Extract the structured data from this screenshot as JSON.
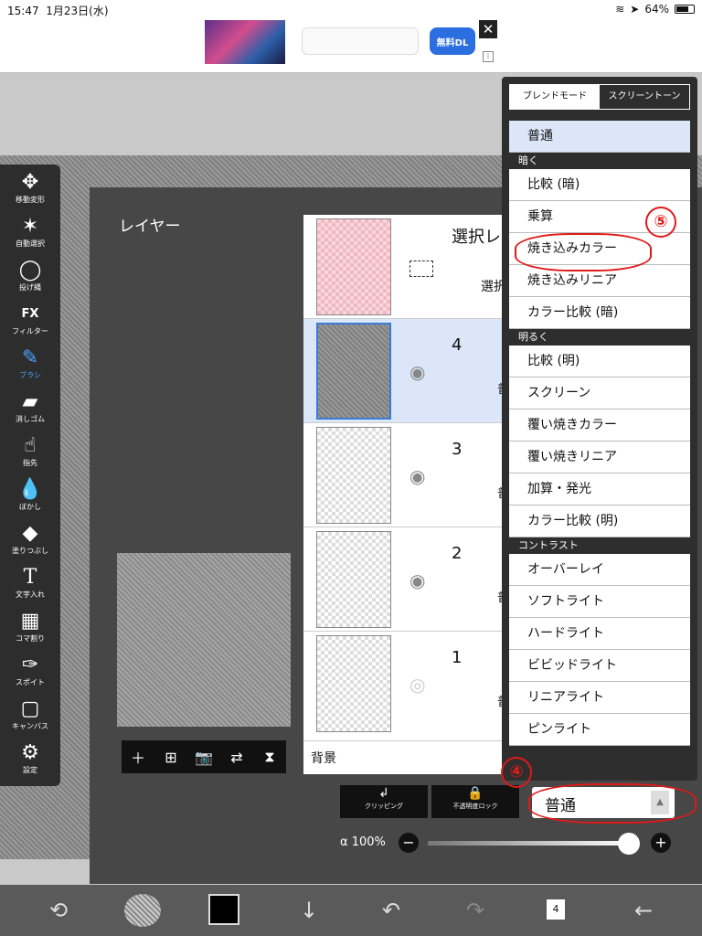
{
  "status_bar": {
    "time": "15:47",
    "date": "1月23日(水)",
    "battery": "64%"
  },
  "ad": {
    "button_label": "無料DL",
    "close": "✕",
    "info": "i"
  },
  "toolbar": {
    "items": [
      {
        "label": "移動変形",
        "icon": "move-icon",
        "glyph": "✥"
      },
      {
        "label": "自動選択",
        "icon": "magic-wand-icon",
        "glyph": "✶"
      },
      {
        "label": "投げ縄",
        "icon": "lasso-icon",
        "glyph": "◯"
      },
      {
        "label": "フィルター",
        "icon": "fx-icon",
        "glyph": "FX"
      },
      {
        "label": "ブラシ",
        "icon": "brush-icon",
        "glyph": "✎"
      },
      {
        "label": "消しゴム",
        "icon": "eraser-icon",
        "glyph": "▰"
      },
      {
        "label": "指先",
        "icon": "finger-icon",
        "glyph": "☝"
      },
      {
        "label": "ぼかし",
        "icon": "blur-icon",
        "glyph": "💧"
      },
      {
        "label": "塗りつぶし",
        "icon": "bucket-icon",
        "glyph": "◆"
      },
      {
        "label": "文字入れ",
        "icon": "text-icon",
        "glyph": "T"
      },
      {
        "label": "コマ割り",
        "icon": "frame-icon",
        "glyph": "▦"
      },
      {
        "label": "スポイト",
        "icon": "eyedropper-icon",
        "glyph": "✑"
      },
      {
        "label": "キャンバス",
        "icon": "canvas-icon",
        "glyph": "▢"
      },
      {
        "label": "設定",
        "icon": "gear-icon",
        "glyph": "⚙"
      }
    ]
  },
  "layer_panel": {
    "title": "レイヤー",
    "selection_layer": {
      "title": "選択レ",
      "subtitle": "選択"
    },
    "layers": [
      {
        "number": "4",
        "mode": "普"
      },
      {
        "number": "3",
        "mode": "普"
      },
      {
        "number": "2",
        "mode": "普"
      },
      {
        "number": "1",
        "mode": "普"
      }
    ],
    "background_label": "背景",
    "clipping_label": "クリッピング",
    "alpha_lock_label": "不透明度ロック",
    "blend_value": "普通",
    "opacity_label": "α 100%"
  },
  "blend_dropdown": {
    "tabs": [
      "ブレンドモード",
      "スクリーントーン"
    ],
    "normal": "普通",
    "dark_header": "暗く",
    "dark_items": [
      "比較 (暗)",
      "乗算",
      "焼き込みカラー",
      "焼き込みリニア",
      "カラー比較 (暗)"
    ],
    "light_header": "明るく",
    "light_items": [
      "比較 (明)",
      "スクリーン",
      "覆い焼きカラー",
      "覆い焼きリニア",
      "加算・発光",
      "カラー比較 (明)"
    ],
    "contrast_header": "コントラスト",
    "contrast_items": [
      "オーバーレイ",
      "ソフトライト",
      "ハードライト",
      "ビビッドライト",
      "リニアライト",
      "ピンライト"
    ]
  },
  "annotations": {
    "step4": "④",
    "step5": "⑤"
  },
  "bottom_bar": {
    "layer_count": "4"
  }
}
